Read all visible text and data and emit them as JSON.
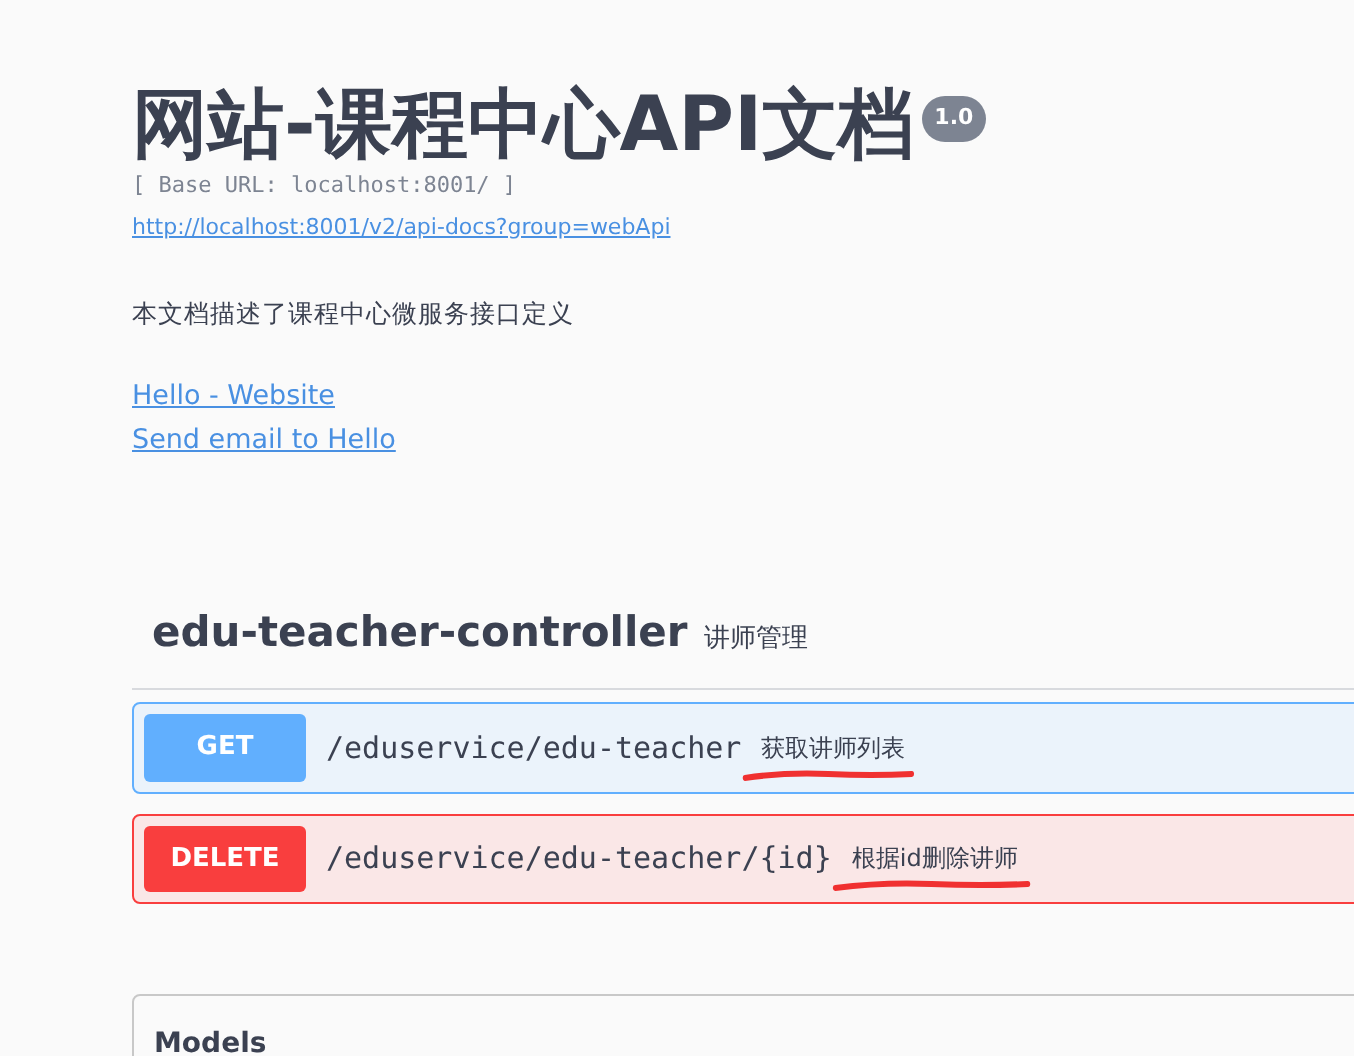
{
  "info": {
    "title": "网站-课程中心API文档",
    "version": "1.0",
    "base_url": "[ Base URL: localhost:8001/ ]",
    "docs_url": "http://localhost:8001/v2/api-docs?group=webApi",
    "description": "本文档描述了课程中心微服务接口定义",
    "links": [
      "Hello - Website",
      "Send email to Hello"
    ]
  },
  "tag": {
    "name": "edu-teacher-controller",
    "description": "讲师管理"
  },
  "operations": [
    {
      "method": "GET",
      "path": "/eduservice/edu-teacher",
      "summary": "获取讲师列表",
      "underlined": true
    },
    {
      "method": "DELETE",
      "path": "/eduservice/edu-teacher/{id}",
      "summary": "根据id删除讲师",
      "underlined": true
    }
  ],
  "models": {
    "title": "Models"
  }
}
